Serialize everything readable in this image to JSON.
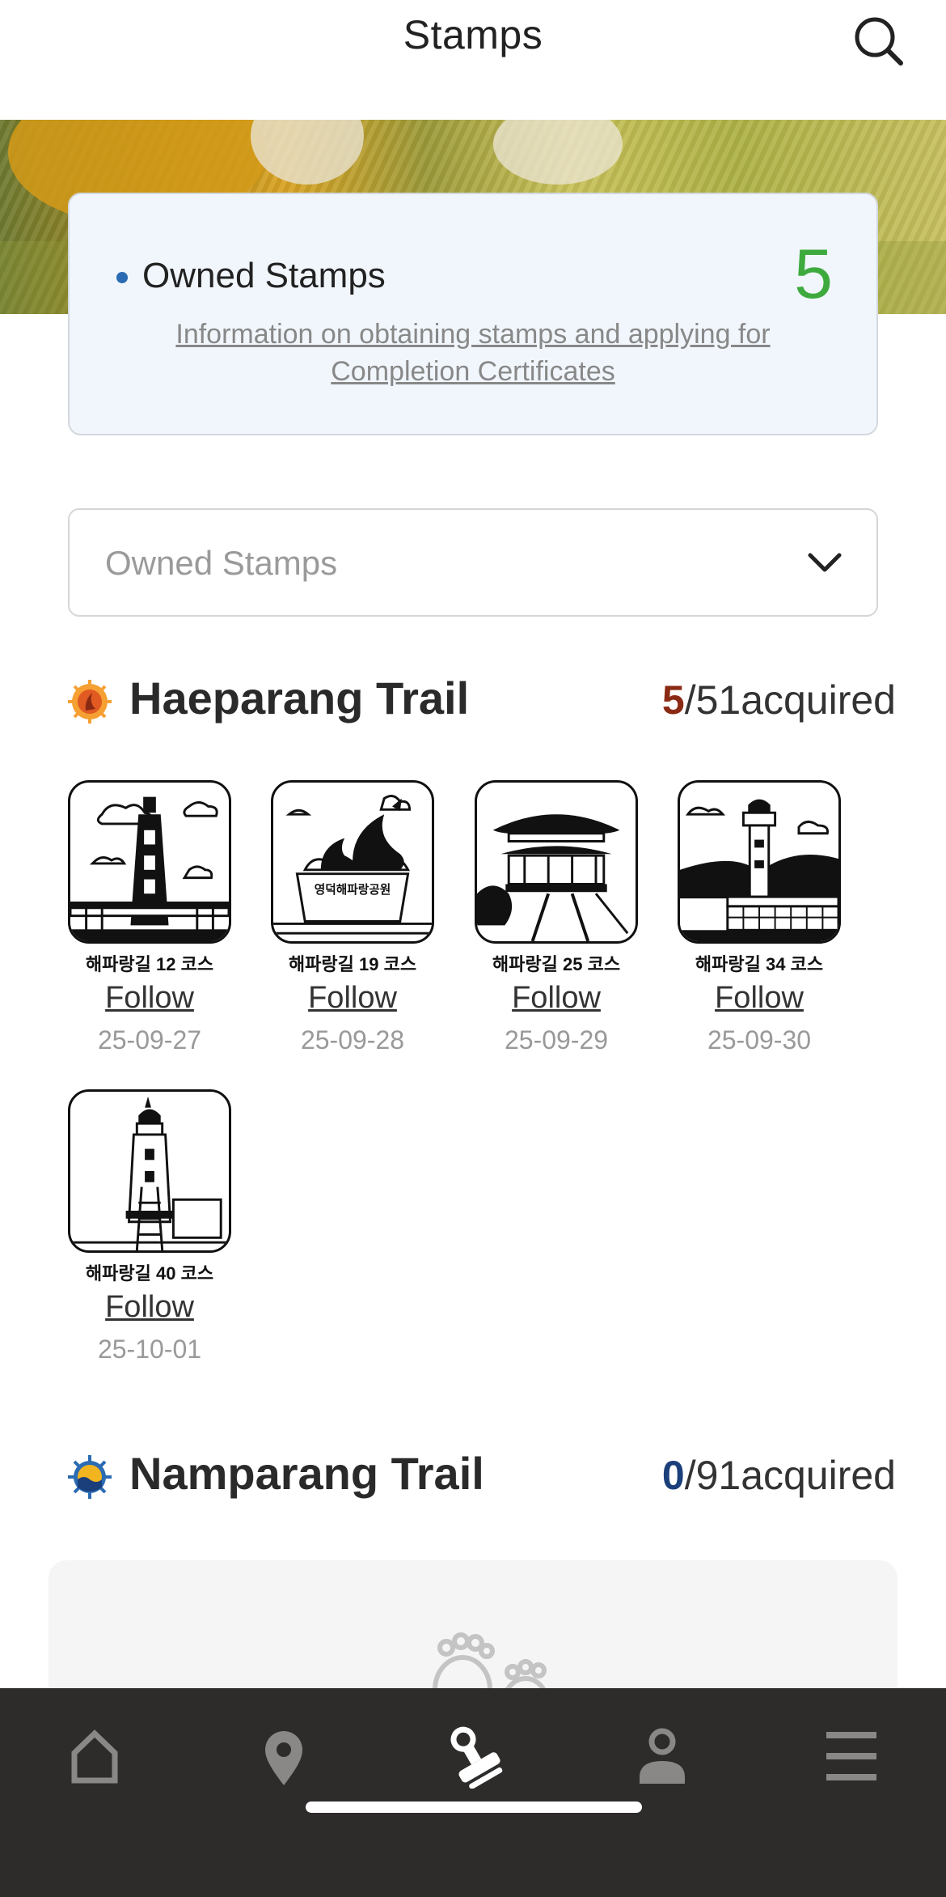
{
  "header": {
    "title": "Stamps"
  },
  "owned": {
    "label": "Owned Stamps",
    "count": "5",
    "info_link": "Information on obtaining stamps and applying for Completion Certificates"
  },
  "filter": {
    "selected": "Owned Stamps"
  },
  "trails": [
    {
      "name": "Haeparang Trail",
      "acquired": "5",
      "total_text": "/51acquired",
      "accent": "#8b2a14",
      "stamps": [
        {
          "name": "해파랑길 12 코스",
          "follow": "Follow",
          "date": "25-09-27"
        },
        {
          "name": "해파랑길 19 코스",
          "follow": "Follow",
          "date": "25-09-28",
          "sign": "영덕해파랑공원"
        },
        {
          "name": "해파랑길 25 코스",
          "follow": "Follow",
          "date": "25-09-29"
        },
        {
          "name": "해파랑길 34 코스",
          "follow": "Follow",
          "date": "25-09-30"
        },
        {
          "name": "해파랑길 40 코스",
          "follow": "Follow",
          "date": "25-10-01"
        }
      ]
    },
    {
      "name": "Namparang Trail",
      "acquired": "0",
      "total_text": "/91acquired",
      "accent": "#1b3f7a",
      "stamps": []
    }
  ],
  "bottom_nav": [
    {
      "icon": "home-icon",
      "active": false
    },
    {
      "icon": "map-pin-icon",
      "active": false
    },
    {
      "icon": "stamp-icon",
      "active": true
    },
    {
      "icon": "person-icon",
      "active": false
    },
    {
      "icon": "menu-icon",
      "active": false
    }
  ],
  "colors": {
    "owned_count": "#3eaa3e",
    "nav_background": "#2e2b2b",
    "nav_icon": "#8a8787",
    "nav_active": "#ffffff"
  }
}
